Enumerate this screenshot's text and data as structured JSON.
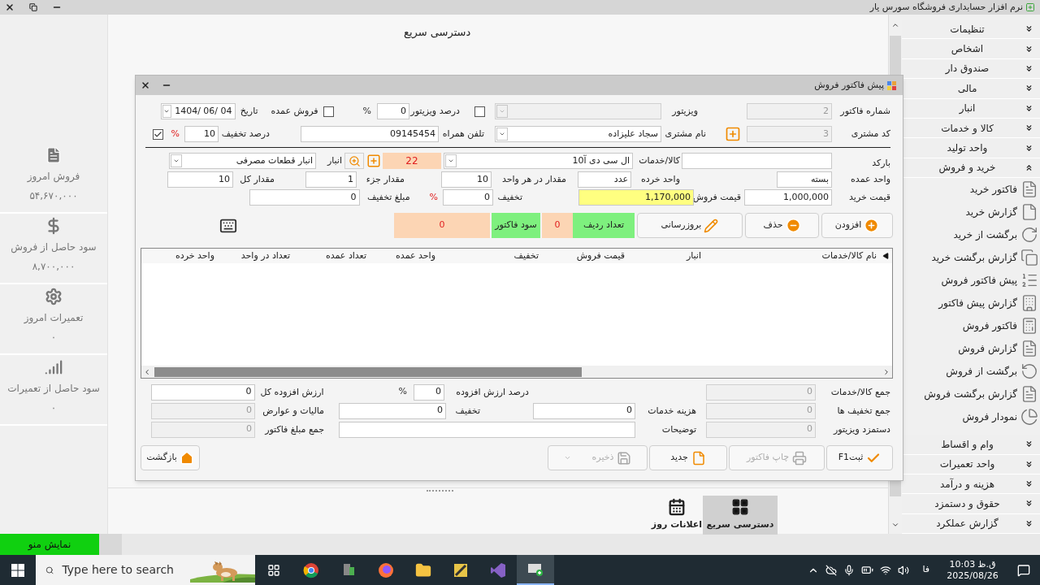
{
  "window": {
    "title": "نرم افزار حسابداری فروشگاه سورس یار"
  },
  "quick_access": {
    "title": "دسترسی سریع"
  },
  "stats": [
    {
      "label": "فروش امروز",
      "value": "۵۴,۶۷۰,۰۰۰"
    },
    {
      "label": "سود حاصل از فروش",
      "value": "۸,۷۰۰,۰۰۰"
    },
    {
      "label": "تعمیرات امروز",
      "value": "۰"
    },
    {
      "label": "سود حاصل از تعمیرات",
      "value": "۰"
    }
  ],
  "sidebar": {
    "items": [
      {
        "label": "تنظیمات",
        "expanded": false
      },
      {
        "label": "اشخاص",
        "expanded": false
      },
      {
        "label": "صندوق دار",
        "expanded": false
      },
      {
        "label": "مالی",
        "expanded": false
      },
      {
        "label": "انبار",
        "expanded": false
      },
      {
        "label": "کالا و خدمات",
        "expanded": false
      },
      {
        "label": "واحد تولید",
        "expanded": false
      },
      {
        "label": "خرید و فروش",
        "expanded": true,
        "children": [
          {
            "label": "فاکتور خرید"
          },
          {
            "label": "گزارش خرید"
          },
          {
            "label": "برگشت از خرید"
          },
          {
            "label": "گزارش برگشت خرید"
          },
          {
            "label": "پیش فاکتور فروش"
          },
          {
            "label": "گزارش پیش فاکتور"
          },
          {
            "label": "فاکتور فروش"
          },
          {
            "label": "گزارش فروش"
          },
          {
            "label": "برگشت از فروش"
          },
          {
            "label": "گزارش برگشت فروش"
          },
          {
            "label": "نمودار فروش"
          }
        ]
      },
      {
        "label": "وام و اقساط",
        "expanded": false
      },
      {
        "label": "واحد تعمیرات",
        "expanded": false
      },
      {
        "label": "هزینه و درآمد",
        "expanded": false
      },
      {
        "label": "حقوق و دستمزد",
        "expanded": false
      },
      {
        "label": "گزارش عملکرد",
        "expanded": false
      }
    ]
  },
  "dialog": {
    "title": "پیش فاکتور فروش",
    "invoice_number": {
      "label": "شماره فاکتور",
      "value": "2",
      "disabled": true
    },
    "visitor": {
      "label": "ویزیتور",
      "disabled": true
    },
    "visitor_enabled": {
      "checked": false
    },
    "visitor_percent": {
      "label": "درصد ویزیتور",
      "value": "0",
      "unit": "%"
    },
    "wholesale": {
      "label": "فروش عمده",
      "checked": false
    },
    "date": {
      "label": "تاریخ",
      "value": "1404/ 06/ 04"
    },
    "customer_code": {
      "label": "کد مشتری",
      "value": "3",
      "disabled": true
    },
    "customer_name": {
      "label": "نام مشتری",
      "value": "سجاد علیزاده"
    },
    "mobile": {
      "label": "تلفن همراه",
      "value": "09145454"
    },
    "discount_percent": {
      "label": "درصد تخفیف",
      "value": "10",
      "unit": "%"
    },
    "discount_apply": {
      "checked": true
    },
    "barcode": {
      "label": "بارکد"
    },
    "product": {
      "label": "کالا/خدمات",
      "value": "ال سی دی آ10"
    },
    "stock": "22",
    "warehouse": {
      "label": "انبار",
      "value": "انبار قطعات مصرفی"
    },
    "wholesale_unit": {
      "label": "واحد عمده",
      "value": "بسته"
    },
    "retail_unit": {
      "label": "واحد خرده",
      "value": "عدد"
    },
    "per_unit": {
      "label": "مقدار در هر واحد",
      "value": "10"
    },
    "part_qty": {
      "label": "مقدار جزء",
      "value": "1"
    },
    "total_qty": {
      "label": "مقدار کل",
      "value": "10"
    },
    "purchase_price": {
      "label": "قیمت خرید",
      "value": "1,000,000"
    },
    "sale_price": {
      "label": "قیمت فروش",
      "value": "1,170,000",
      "focused": true
    },
    "item_discount": {
      "label": "تخفیف",
      "value": "0",
      "unit": "%"
    },
    "discount_amount": {
      "label": "مبلغ تخفیف",
      "value": "0"
    },
    "row_actions": [
      {
        "label": "افزودن"
      },
      {
        "label": "حذف"
      },
      {
        "label": "بروزرسانی"
      }
    ],
    "row_count": {
      "label": "تعداد ردیف",
      "value": "0"
    },
    "invoice_profit": {
      "label": "سود فاکتور",
      "value": "0"
    },
    "table": {
      "columns": [
        "نام کالا/خدمات",
        "انبار",
        "قیمت فروش",
        "تخفیف",
        "واحد عمده",
        "تعداد عمده",
        "تعداد در واحد",
        "واحد خرده"
      ]
    },
    "goods_total": {
      "label": "جمع کالا/خدمات",
      "value": "0",
      "disabled": true
    },
    "discounts_total": {
      "label": "جمع تخفیف ها",
      "value": "0",
      "disabled": true
    },
    "visitor_fee": {
      "label": "دستمزد ویزیتور",
      "value": "0",
      "disabled": true
    },
    "vat_percent": {
      "label": "درصد ارزش افزوده",
      "value": "0",
      "unit": "%"
    },
    "service_cost": {
      "label": "هزینه خدمات",
      "value": "0"
    },
    "total_discount": {
      "label": "تخفیف",
      "value": "0"
    },
    "notes": {
      "label": "توضیحات"
    },
    "vat_total": {
      "label": "ارزش افزوده کل",
      "value": "0",
      "disabled": false
    },
    "tax": {
      "label": "مالیات و عوارض",
      "value": "0",
      "disabled": true
    },
    "invoice_sum": {
      "label": "جمع مبلغ فاکتور",
      "value": "0",
      "disabled": true
    },
    "actions": [
      {
        "label": "ثبتF1",
        "disabled": false
      },
      {
        "label": "چاپ فاکتور",
        "disabled": true
      },
      {
        "label": "جدید",
        "disabled": false
      },
      {
        "label": "ذخیره",
        "disabled": true
      }
    ],
    "back": {
      "label": "بازگشت"
    }
  },
  "bottom_tabs": [
    {
      "label": "دسترسی سریع",
      "selected": true
    },
    {
      "label": "اعلانات روز",
      "selected": false
    }
  ],
  "show_menu": "نمایش منو",
  "taskbar": {
    "search_placeholder": "Type here to search",
    "language": "فا",
    "time": "10:03",
    "period": "ق.ظ",
    "date": "2025/08/26"
  }
}
